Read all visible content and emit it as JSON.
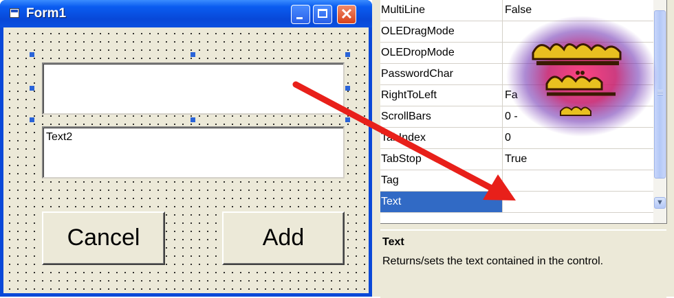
{
  "form": {
    "title": "Form1",
    "textbox1": "",
    "textbox2": "Text2",
    "cancel_label": "Cancel",
    "add_label": "Add"
  },
  "properties": {
    "rows": [
      {
        "name": "MultiLine",
        "value": "False"
      },
      {
        "name": "OLEDragMode",
        "value": ""
      },
      {
        "name": "OLEDropMode",
        "value": ""
      },
      {
        "name": "PasswordChar",
        "value": ""
      },
      {
        "name": "RightToLeft",
        "value": "Fa"
      },
      {
        "name": "ScrollBars",
        "value": "0 -"
      },
      {
        "name": "TabIndex",
        "value": "0"
      },
      {
        "name": "TabStop",
        "value": "True"
      },
      {
        "name": "Tag",
        "value": ""
      },
      {
        "name": "Text",
        "value": ""
      }
    ],
    "selected_row": "Text",
    "description": {
      "title": "Text",
      "text": "Returns/sets the text contained in the control."
    }
  },
  "icons": [
    "form-icon",
    "minimize-icon",
    "maximize-icon",
    "close-icon",
    "scroll-down-arrow-icon",
    "red-arrow-annotation",
    "watermark-logo"
  ],
  "colors": {
    "titlebar": "#0848d8",
    "selection": "#316ac5",
    "arrow": "#e8201a",
    "face": "#ece9d8"
  }
}
